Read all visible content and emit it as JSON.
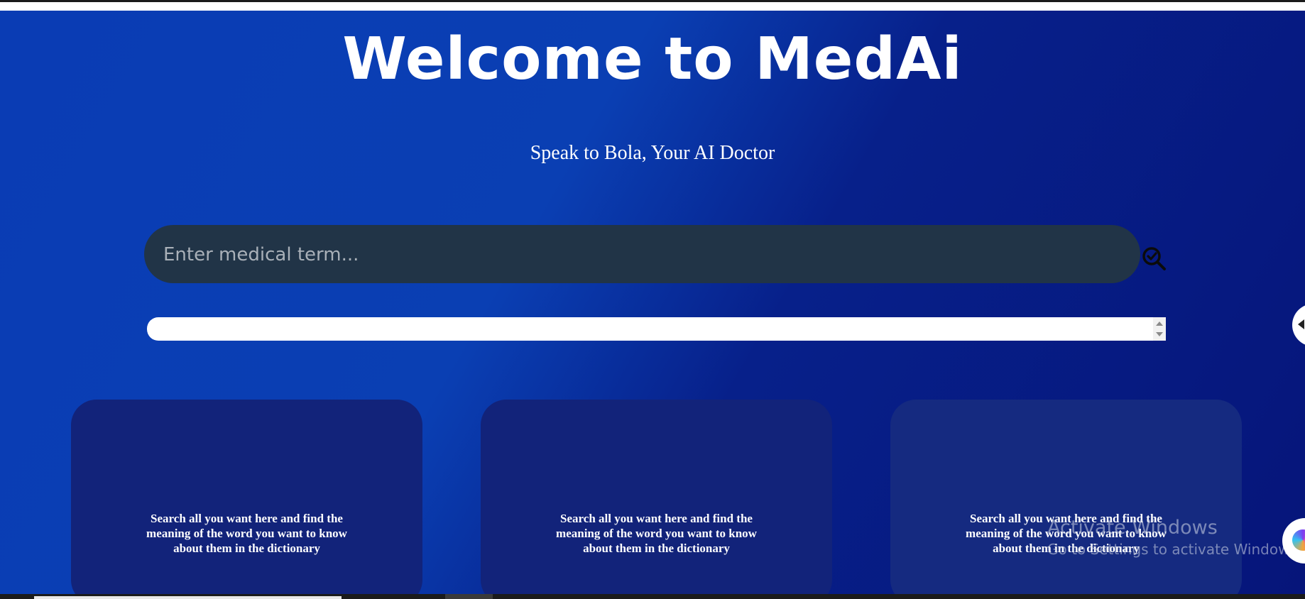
{
  "header": {
    "title": "Welcome to MedAi",
    "subtitle": "Speak to Bola, Your AI Doctor"
  },
  "search": {
    "placeholder": "Enter medical term...",
    "value": "",
    "icon": "search-check-icon"
  },
  "cards": [
    {
      "text": "Search all you want here and find the meaning of the word you want to know about them in the dictionary"
    },
    {
      "text": "Search all you want here and find the meaning of the word you want to know about them in the dictionary"
    },
    {
      "text": "Search all you want here and find the meaning of the word you want to know about them in the dictionary"
    }
  ],
  "watermark": {
    "title": "Activate Windows",
    "subtitle": "Go to Settings to activate Windows."
  },
  "colors": {
    "background_start": "#0a3cb4",
    "background_end": "#06157a",
    "search_bg": "#213447",
    "card_bg": "#12237a",
    "text": "#ffffff"
  }
}
